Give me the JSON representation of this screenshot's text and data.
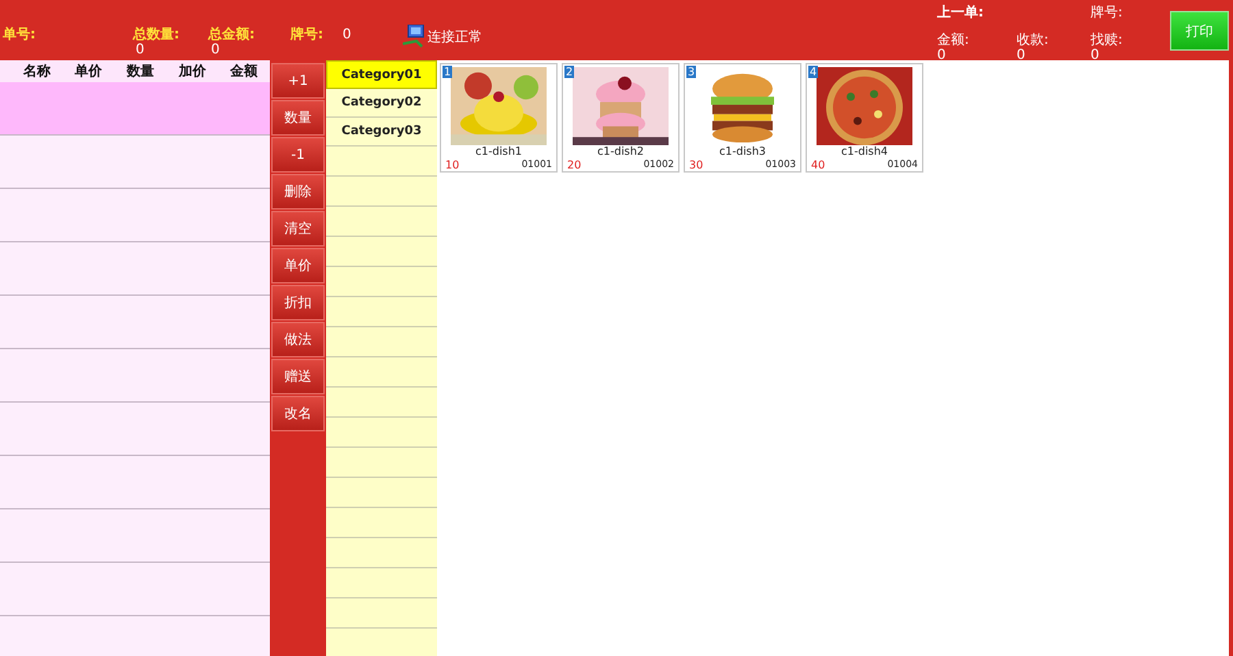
{
  "header": {
    "order_fields": [
      {
        "label": "单号:"
      },
      {
        "label": "总数量:",
        "value": "0"
      },
      {
        "label": "总金额:",
        "value": "0"
      }
    ],
    "tag_number": {
      "label": "牌号:",
      "value": "0"
    },
    "connection": {
      "status": "连接正常"
    },
    "last_order": {
      "title": "上一单:",
      "tag_label": "牌号:",
      "fields": [
        {
          "label": "金额:",
          "value": "0"
        },
        {
          "label": "收款:",
          "value": "0"
        },
        {
          "label": "找赎:",
          "value": "0"
        }
      ]
    },
    "print_button": "打印"
  },
  "order_table": {
    "columns": [
      "名称",
      "单价",
      "数量",
      "加价",
      "金额"
    ],
    "rows": [
      {
        "selected": true
      },
      {
        "selected": false
      },
      {
        "selected": false
      },
      {
        "selected": false
      },
      {
        "selected": false
      },
      {
        "selected": false
      },
      {
        "selected": false
      },
      {
        "selected": false
      },
      {
        "selected": false
      },
      {
        "selected": false
      }
    ]
  },
  "actions": [
    "+1",
    "数量",
    "-1",
    "删除",
    "清空",
    "单价",
    "折扣",
    "做法",
    "赠送",
    "改名"
  ],
  "categories": [
    {
      "label": "Category01",
      "selected": true
    },
    {
      "label": "Category02",
      "selected": false
    },
    {
      "label": "Category03",
      "selected": false
    }
  ],
  "dishes": [
    {
      "index": "1",
      "name": "c1-dish1",
      "price": "10",
      "code": "01001",
      "kind": "picture"
    },
    {
      "index": "2",
      "name": "c1-dish2",
      "price": "20",
      "code": "01002",
      "kind": "picture"
    },
    {
      "index": "3",
      "name": "c1-dish3",
      "price": "30",
      "code": "01003",
      "kind": "picture"
    },
    {
      "index": "4",
      "name": "c1-dish4",
      "price": "40",
      "code": "01004",
      "kind": "picture"
    }
  ]
}
